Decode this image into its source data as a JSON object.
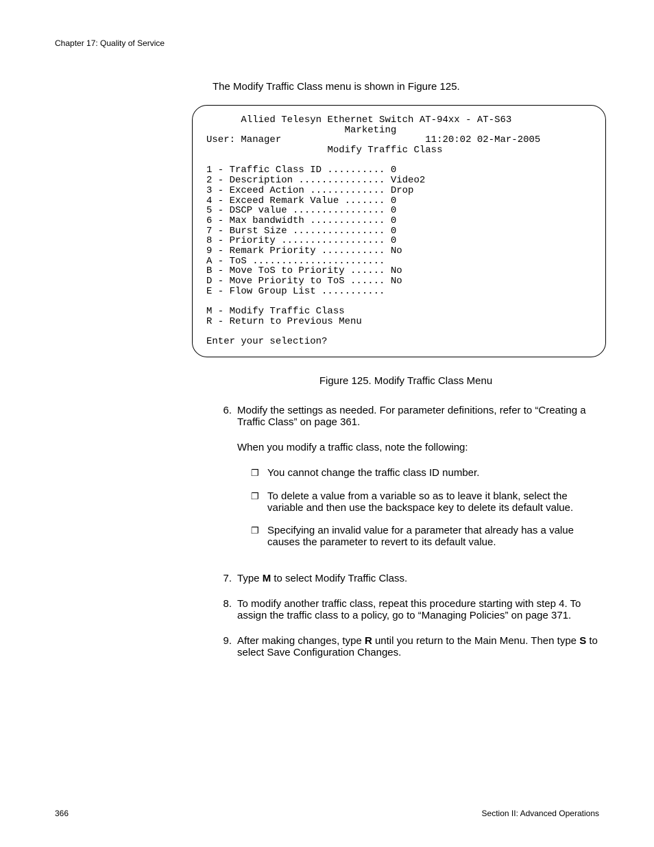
{
  "header": {
    "chapter": "Chapter 17: Quality of Service"
  },
  "intro": "The Modify Traffic Class menu is shown in Figure 125.",
  "terminal": {
    "title1": "Allied Telesyn Ethernet Switch AT-94xx - AT-S63",
    "title2": "Marketing",
    "user": "User: Manager",
    "timestamp": "11:20:02 02-Mar-2005",
    "menu_title": "Modify Traffic Class",
    "options": [
      "1 - Traffic Class ID .......... 0",
      "2 - Description ............... Video2",
      "3 - Exceed Action ............. Drop",
      "4 - Exceed Remark Value ....... 0",
      "5 - DSCP value ................ 0",
      "6 - Max bandwidth ............. 0",
      "7 - Burst Size ................ 0",
      "8 - Priority .................. 0",
      "9 - Remark Priority ........... No",
      "A - ToS .......................",
      "B - Move ToS to Priority ...... No",
      "D - Move Priority to ToS ...... No",
      "E - Flow Group List ..........."
    ],
    "actions": [
      "M - Modify Traffic Class",
      "R - Return to Previous Menu"
    ],
    "prompt": "Enter your selection?"
  },
  "figure_caption": "Figure 125. Modify Traffic Class Menu",
  "steps": {
    "s6": {
      "num": "6.",
      "p1": "Modify the settings as needed. For parameter definitions, refer to “Creating a Traffic Class” on page 361.",
      "p2": "When you modify a traffic class, note the following:",
      "bullets": [
        "You cannot change the traffic class ID number.",
        "To delete a value from a variable so as to leave it blank, select the variable and then use the backspace key to delete its default value.",
        "Specifying an invalid value for a parameter that already has a value causes the parameter to revert to its default value."
      ]
    },
    "s7": {
      "num": "7.",
      "pre": "Type ",
      "key": "M",
      "post": " to select Modify Traffic Class."
    },
    "s8": {
      "num": "8.",
      "text": "To modify another traffic class, repeat this procedure starting with step 4. To assign the traffic class to a policy, go to “Managing Policies” on page 371."
    },
    "s9": {
      "num": "9.",
      "pre": "After making changes, type ",
      "key1": "R",
      "mid": " until you return to the Main Menu. Then type ",
      "key2": "S",
      "post": " to select Save Configuration Changes."
    }
  },
  "footer": {
    "page": "366",
    "section": "Section II: Advanced Operations"
  }
}
